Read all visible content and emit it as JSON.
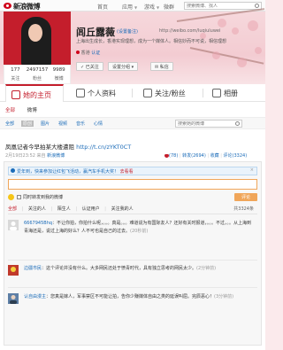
{
  "colors": {
    "accent": "#c41e2c",
    "link": "#1a6bb8",
    "button": "#f0a65a"
  },
  "topnav": {
    "logo": "新浪微博",
    "tabs": [
      {
        "label": "首页",
        "icon": ""
      },
      {
        "label": "应用",
        "icon": "chevron-down"
      },
      {
        "label": "游戏",
        "icon": "chevron-down"
      },
      {
        "label": "微群",
        "icon": "chevron-down"
      }
    ],
    "search_placeholder": "搜索微博、找人"
  },
  "profile": {
    "name": "闾丘露薇",
    "verify": "(设置备注)",
    "url": "http://weibo.com/luqiuluwei",
    "bio": "上海出生成长，香港实现理想，成为一个媒体人。相信妙而不可说，相信理想",
    "location": "香港",
    "cert": "认证",
    "stats": [
      {
        "num": "177",
        "label": "关注"
      },
      {
        "num": "2497157",
        "label": "粉丝"
      },
      {
        "num": "9989",
        "label": "微博"
      }
    ],
    "buttons": {
      "followed": "✓ 已关注",
      "group": "设置分组",
      "message": "私信"
    }
  },
  "tabs": [
    {
      "label": "她的主页",
      "icon": "home-icon"
    },
    {
      "label": "个人资料",
      "icon": "profile-icon"
    },
    {
      "label": "关注/粉丝",
      "icon": "follow-icon"
    },
    {
      "label": "相册",
      "icon": "album-icon"
    }
  ],
  "feed": {
    "sub_tabs": [
      "全部",
      "微博"
    ],
    "filters": [
      "全部",
      "原创",
      "图片",
      "视频",
      "音乐",
      "心情"
    ],
    "search_placeholder": "搜索她的微博",
    "post": {
      "text": "凤凰记者今早拍某大楼遭阻",
      "link": "http://t.cn/zYKT0CT",
      "time": "2月19日23:52",
      "via": "来自",
      "source": "新浪微博",
      "like_count": "(78)",
      "repost": "转发(2694)",
      "fav": "收藏",
      "comment": "评论(3324)"
    }
  },
  "comment_box": {
    "notice": "爱年到，快来参加让红包飞活动，赢汽车手机大奖！",
    "notice_link": "去看看",
    "close": "×",
    "repost_label": "同时转发到我的微博",
    "submit": "评论",
    "tabs": [
      "全部",
      "|",
      "关注的人",
      "|",
      "陌生人",
      "|",
      "认证用户",
      "|",
      "关注我的人"
    ],
    "total": "共3324条"
  },
  "comments": [
    {
      "user": "6667945Bhq",
      "text": "：不让你拍，你拍什么呢，。。。真是。。。难道说为有国际友人？还好有关时报道，。。。不过。。。从上海到青海还是，说过上海的好么？人不可也是自己的过去。",
      "time": "(20秒前)"
    },
    {
      "user": "边疆市民",
      "text": "：这个评论并没有什么。大多网民还处于愤青时代，具有独立思考的网民太少。",
      "time": "(2分钟前)"
    },
    {
      "user": "认自由漫主",
      "text": "：您真是嫁人，军事禁区不可能让拍，告你少赚媒体自由之类的延误叫屈。完辰恶心！",
      "time": "(3分钟前)"
    }
  ]
}
